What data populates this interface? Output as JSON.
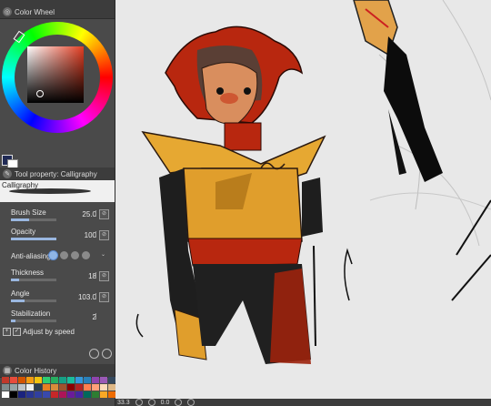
{
  "color_wheel": {
    "title": "Color Wheel",
    "r": "52",
    "g": "43",
    "b": "40",
    "hue_color": "#e23d22",
    "main_color": "#202a55",
    "sub_color": "#ffffff"
  },
  "tool_property": {
    "title": "Tool property: Calligraphy",
    "brush_name": "Calligraphy",
    "props": [
      {
        "label": "Brush Size",
        "value": "25.0",
        "fill": 0.4
      },
      {
        "label": "Opacity",
        "value": "100",
        "fill": 1.0
      },
      {
        "label": "Anti-aliasing",
        "value": ""
      },
      {
        "label": "Thickness",
        "value": "18",
        "fill": 0.18
      },
      {
        "label": "Angle",
        "value": "103.0",
        "fill": 0.3
      },
      {
        "label": "Stabilization",
        "value": "2",
        "fill": 0.1
      }
    ],
    "adjust_label": "Adjust by speed"
  },
  "color_history": {
    "title": "Color History",
    "colors": [
      "#c0392b",
      "#e74c3c",
      "#d35400",
      "#f39c12",
      "#f1c40f",
      "#2ecc71",
      "#27ae60",
      "#16a085",
      "#1abc9c",
      "#3498db",
      "#2980b9",
      "#8e44ad",
      "#9b59b6",
      "#34495e",
      "#7f8c8d",
      "#95a5a6",
      "#bdc3c7",
      "#ecf0f1",
      "#2c3e50",
      "#e67e22",
      "#d98c3a",
      "#a0522d",
      "#8b0000",
      "#b22222",
      "#ff7f50",
      "#ffa07a",
      "#ffdab9",
      "#deb887",
      "#ffffff",
      "#000000",
      "#1a237e",
      "#283593",
      "#303f9f",
      "#3949ab",
      "#c62828",
      "#ad1457",
      "#6a1b9a",
      "#4527a0",
      "#00695c",
      "#2e7d32",
      "#f9a825",
      "#ef6c00"
    ]
  },
  "status": {
    "zoom": "33.3",
    "angle": "0.0"
  }
}
